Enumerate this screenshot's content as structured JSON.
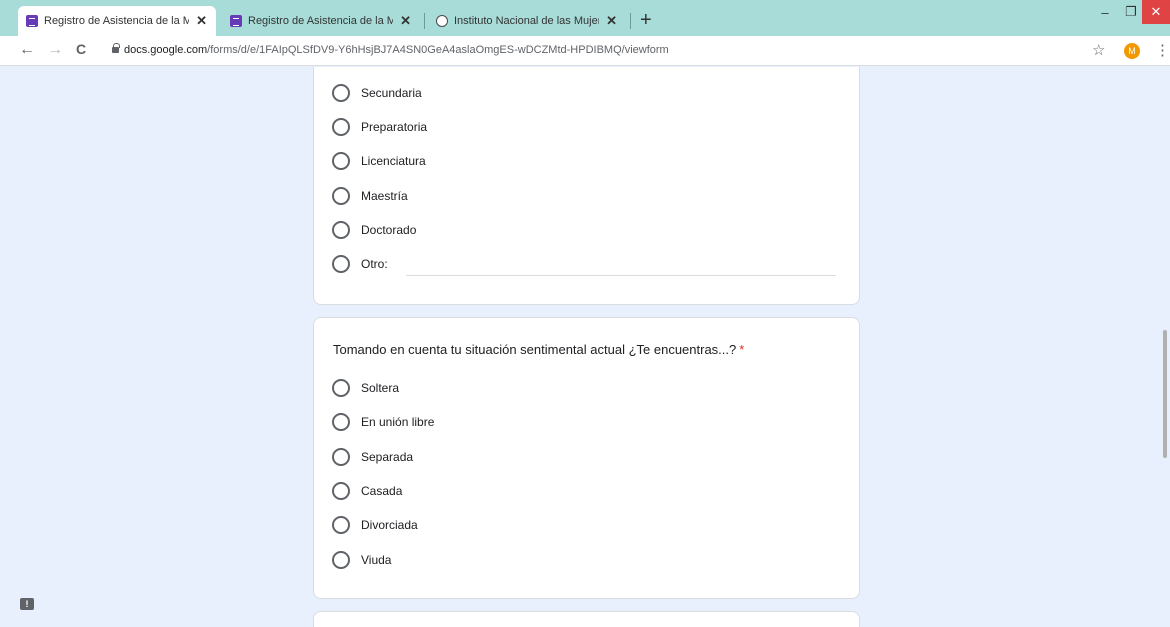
{
  "tabs": [
    {
      "label": "Registro de Asistencia de la Mes",
      "close": "✕"
    },
    {
      "label": "Registro de Asistencia de la Mes",
      "close": "✕"
    },
    {
      "label": "Instituto Nacional de las Mujeres",
      "close": "✕"
    }
  ],
  "new_tab": "+",
  "window_controls": {
    "minimize": "–",
    "maximize": "❐",
    "close": "✕"
  },
  "nav": {
    "back": "←",
    "forward": "→",
    "reload": "C"
  },
  "address": {
    "host": "docs.google.com",
    "path": "/forms/d/e/1FAIpQLSfDV9-Y6hHsjBJ7A4SN0GeA4aslaOmgES-wDCZMtd-HPDIBMQ/viewform"
  },
  "star": "☆",
  "profile_initial": "M",
  "menu": "⋮",
  "section1": {
    "options": [
      "Secundaria",
      "Preparatoria",
      "Licenciatura",
      "Maestría",
      "Doctorado",
      "Otro:"
    ]
  },
  "section2": {
    "question": "Tomando en cuenta tu situación sentimental actual ¿Te encuentras...?",
    "required_mark": "*",
    "options": [
      "Soltera",
      "En unión libre",
      "Separada",
      "Casada",
      "Divorciada",
      "Viuda"
    ]
  },
  "feedback_icon": "!",
  "colors": {
    "tab_strip": "#a8dcd8",
    "page_bg": "#e8f0fe",
    "required": "#d93025",
    "profile": "#f29900"
  }
}
